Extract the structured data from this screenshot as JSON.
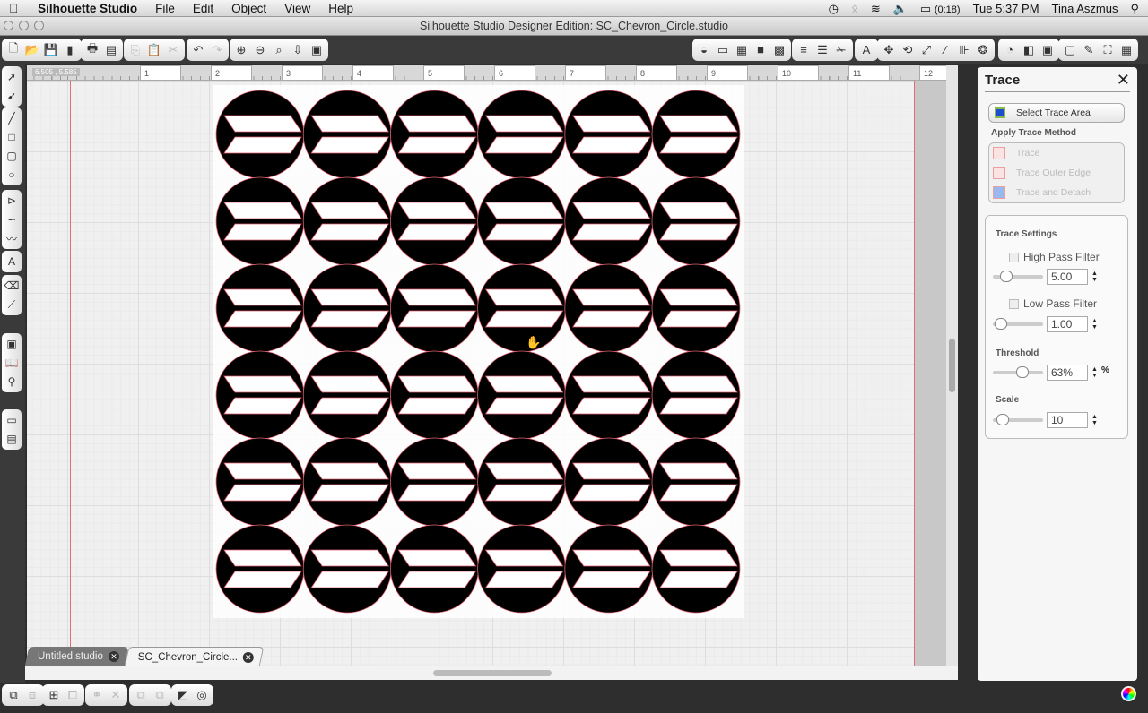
{
  "menubar": {
    "app_name": "Silhouette Studio",
    "items": [
      "File",
      "Edit",
      "Object",
      "View",
      "Help"
    ],
    "status": {
      "battery": "(0:18)",
      "clock": "Tue 5:37 PM",
      "user": "Tina Aszmus"
    }
  },
  "window": {
    "title": "Silhouette Studio Designer Edition: SC_Chevron_Circle.studio"
  },
  "toolbar_left_groups": [
    [
      "new-document-icon",
      "open-folder-icon",
      "save-icon",
      "save-to-library-icon"
    ],
    [
      "print-icon",
      "send-to-cutter-icon"
    ],
    [
      "copy-icon",
      "paste-icon",
      "cut-icon"
    ],
    [
      "undo-icon",
      "redo-icon"
    ],
    [
      "zoom-in-icon",
      "zoom-out-icon",
      "zoom-select-icon",
      "pan-icon",
      "fit-to-page-icon"
    ]
  ],
  "toolbar_right_groups": [
    [
      "fill-color-icon",
      "page-setup-icon",
      "grid-icon",
      "registration-marks-icon",
      "cut-settings-icon"
    ],
    [
      "line-color-icon",
      "line-style-icon",
      "knife-icon"
    ],
    [
      "text-style-icon"
    ],
    [
      "align-icon",
      "rotate-icon",
      "scale-icon",
      "shear-icon",
      "replicate-icon",
      "modify-icon"
    ],
    [
      "library-icon",
      "store-icon",
      "trace-icon"
    ],
    [
      "offset-icon",
      "sketch-icon",
      "fullscreen-icon",
      "grid-view-icon"
    ]
  ],
  "left_tool_groups": [
    [
      "select-arrow-icon",
      "point-edit-icon"
    ],
    [
      "line-tool-icon",
      "rectangle-tool-icon",
      "rounded-rectangle-tool-icon",
      "ellipse-tool-icon"
    ],
    [
      "polygon-tool-icon",
      "curve-tool-icon",
      "freehand-tool-icon"
    ],
    [
      "text-tool-icon"
    ],
    [
      "eraser-tool-icon",
      "knife-tool-icon"
    ],
    [
      "trace-panel-icon",
      "library-panel-icon",
      "store-panel-icon"
    ],
    [
      "layer-view-icon",
      "split-view-icon"
    ]
  ],
  "ruler": {
    "coordinate_readout": "6.505 , 5.585",
    "labels": [
      "1",
      "2",
      "3",
      "4",
      "5",
      "6",
      "7",
      "8",
      "9",
      "10",
      "11",
      "12"
    ]
  },
  "design": {
    "name": "Chevron Circle pattern",
    "rows": 6,
    "columns": 6,
    "fill": "#000000",
    "cut_line_color": "#e06070"
  },
  "tabs": [
    {
      "label": "Untitled.studio",
      "active": false
    },
    {
      "label": "SC_Chevron_Circle...",
      "active": true
    }
  ],
  "bottom_toolbar_groups": [
    [
      "group-icon",
      "ungroup-icon"
    ],
    [
      "make-compound-path-icon",
      "release-compound-path-icon"
    ],
    [
      "weld-icon",
      "delete-icon"
    ],
    [
      "bring-to-front-icon",
      "send-to-back-icon"
    ],
    [
      "media-icon",
      "target-icon"
    ]
  ],
  "trace_panel": {
    "title": "Trace",
    "select_trace_area": "Select Trace Area",
    "apply_method_label": "Apply Trace Method",
    "methods": [
      "Trace",
      "Trace Outer Edge",
      "Trace and Detach"
    ],
    "settings_label": "Trace Settings",
    "high_pass": {
      "label": "High Pass Filter",
      "checked": false,
      "value": "5.00",
      "slider_fraction": 0.2
    },
    "low_pass": {
      "label": "Low Pass Filter",
      "checked": false,
      "value": "1.00",
      "slider_fraction": 0.05
    },
    "threshold": {
      "label": "Threshold",
      "value": "63%",
      "unit": "%",
      "slider_fraction": 0.63
    },
    "scale": {
      "label": "Scale",
      "value": "10",
      "slider_fraction": 0.1
    }
  }
}
